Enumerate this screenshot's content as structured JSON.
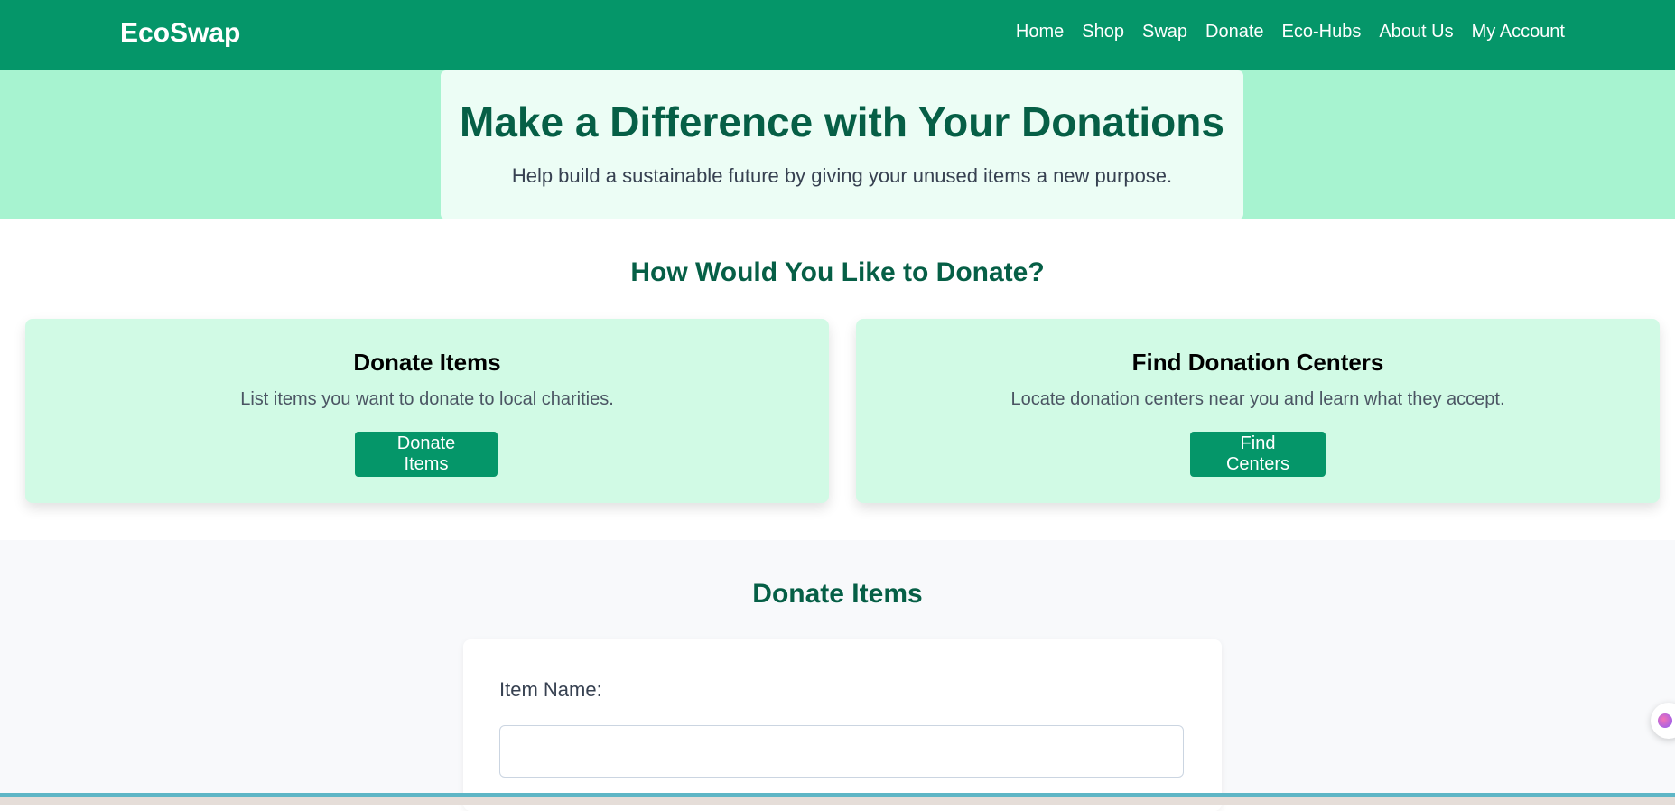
{
  "brand": {
    "name": "EcoSwap"
  },
  "nav": {
    "links": [
      "Home",
      "Shop",
      "Swap",
      "Donate",
      "Eco-Hubs",
      "About Us",
      "My Account"
    ]
  },
  "hero": {
    "title": "Make a Difference with Your Donations",
    "subtitle": "Help build a sustainable future by giving your unused items a new purpose."
  },
  "options": {
    "heading": "How Would You Like to Donate?",
    "cards": [
      {
        "title": "Donate Items",
        "text": "List items you want to donate to local charities.",
        "button": "Donate Items"
      },
      {
        "title": "Find Donation Centers",
        "text": "Locate donation centers near you and learn what they accept.",
        "button": "Find Centers"
      }
    ]
  },
  "form": {
    "heading": "Donate Items",
    "item_name_label": "Item Name:",
    "item_name_value": ""
  },
  "colors": {
    "primary": "#059669",
    "hero_bg": "#a7f3d0",
    "card_bg": "#d1fae5",
    "heading": "#065f46"
  },
  "icons": {
    "floating_widget": "assistant-icon"
  }
}
